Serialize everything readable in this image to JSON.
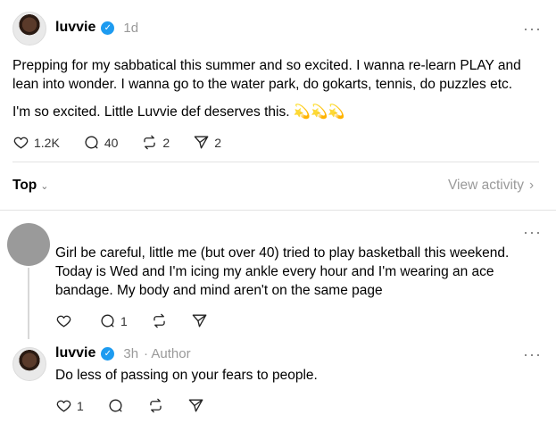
{
  "post": {
    "username": "luvvie",
    "time": "1d",
    "text1": "Prepping for my sabbatical this summer and so excited. I wanna re-learn PLAY and lean into wonder. I wanna go to the water park, do gokarts, tennis, do puzzles etc.",
    "text2": "I'm so excited. Little Luvvie def deserves this. 💫💫💫",
    "likes": "1.2K",
    "comments": "40",
    "reposts": "2",
    "shares": "2"
  },
  "sort": {
    "label": "Top",
    "view_activity": "View activity"
  },
  "reply1": {
    "text": "Girl be careful, little me (but over 40) tried to play basketball this weekend. Today is Wed and I'm icing my ankle every hour and I'm wearing an ace bandage. My body and mind aren't on the same page",
    "comments": "1"
  },
  "reply2": {
    "username": "luvvie",
    "time": "3h",
    "author": "· Author",
    "text": "Do less of passing on your fears to people.",
    "likes": "1"
  },
  "icons": {
    "verified": "verified-badge-icon",
    "more": "more-horizontal-icon",
    "like": "heart-icon",
    "comment": "comment-bubble-icon",
    "repost": "repost-icon",
    "share": "send-icon"
  },
  "colors": {
    "verified": "#1d9bf0",
    "muted": "#999999"
  }
}
